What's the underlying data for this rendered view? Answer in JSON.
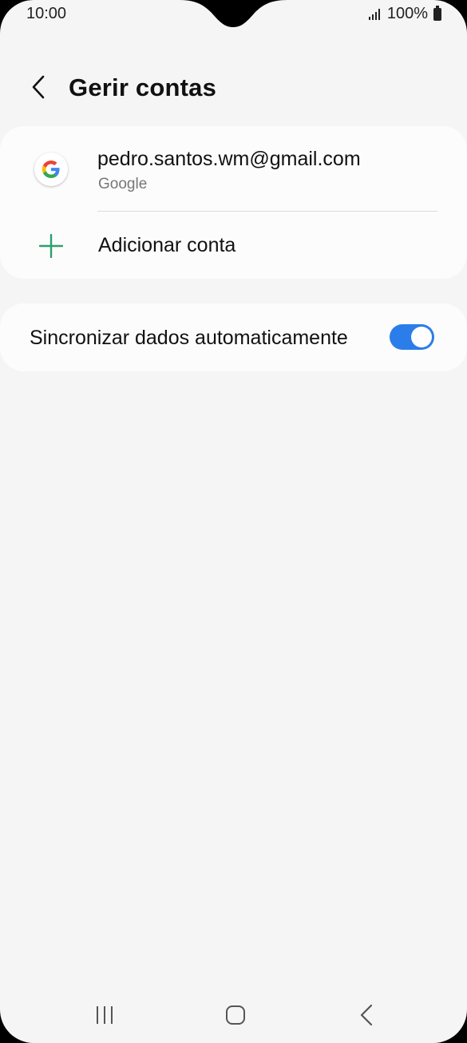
{
  "status_bar": {
    "time": "10:00",
    "battery": "100%"
  },
  "header": {
    "title": "Gerir contas",
    "back_icon": "chevron-left-icon"
  },
  "accounts": {
    "items": [
      {
        "email": "pedro.santos.wm@gmail.com",
        "type": "Google",
        "icon": "google-icon"
      }
    ],
    "add_label": "Adicionar conta",
    "add_icon": "plus-icon",
    "accent_color": "#2e9e6f"
  },
  "sync": {
    "label": "Sincronizar dados automaticamente",
    "enabled": true,
    "toggle_color": "#2b7de9"
  },
  "nav_bar": {
    "recents_icon": "recents-icon",
    "home_icon": "home-icon",
    "back_icon": "back-icon"
  }
}
